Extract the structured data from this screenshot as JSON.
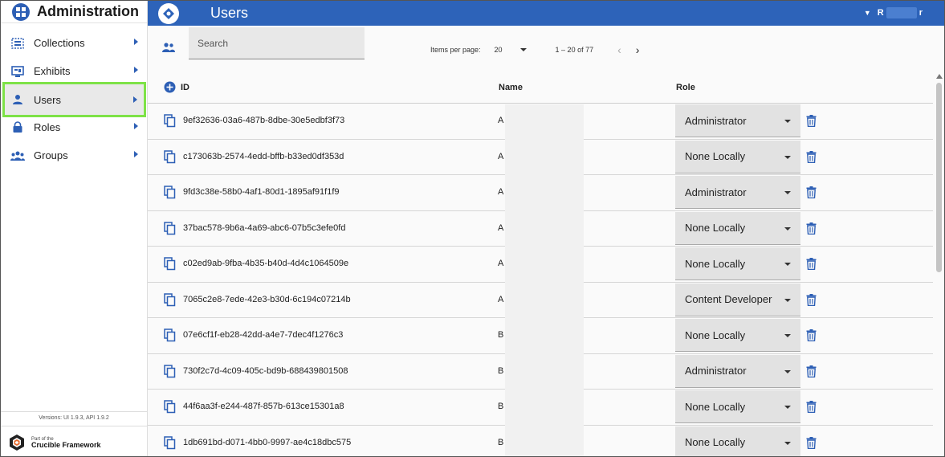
{
  "sidebar": {
    "title": "Administration",
    "items": [
      {
        "label": "Collections",
        "icon": "collections-icon"
      },
      {
        "label": "Exhibits",
        "icon": "exhibits-icon"
      },
      {
        "label": "Users",
        "icon": "user-icon",
        "active": true
      },
      {
        "label": "Roles",
        "icon": "lock-icon"
      },
      {
        "label": "Groups",
        "icon": "groups-icon"
      }
    ],
    "versions": "Versions: UI 1.9.3, API 1.9.2",
    "footer_small": "Part of the",
    "footer_big": "Crucible Framework"
  },
  "topbar": {
    "title": "Users",
    "user_initial": "R",
    "user_suffix": "r"
  },
  "toolbar": {
    "search_placeholder": "Search",
    "items_per_page_label": "Items per page:",
    "items_per_page": "20",
    "range": "1 – 20 of 77"
  },
  "table": {
    "headers": {
      "id": "ID",
      "name": "Name",
      "role": "Role"
    },
    "rows": [
      {
        "id": "9ef32636-03a6-487b-8dbe-30e5edbf3f73",
        "name": "A",
        "role": "Administrator"
      },
      {
        "id": "c173063b-2574-4edd-bffb-b33ed0df353d",
        "name": "A",
        "role": "None Locally"
      },
      {
        "id": "9fd3c38e-58b0-4af1-80d1-1895af91f1f9",
        "name": "A",
        "role": "Administrator"
      },
      {
        "id": "37bac578-9b6a-4a69-abc6-07b5c3efe0fd",
        "name": "A",
        "role": "None Locally"
      },
      {
        "id": "c02ed9ab-9fba-4b35-b40d-4d4c1064509e",
        "name": "A",
        "role": "None Locally"
      },
      {
        "id": "7065c2e8-7ede-42e3-b30d-6c194c07214b",
        "name": "A",
        "role": "Content Developer"
      },
      {
        "id": "07e6cf1f-eb28-42dd-a4e7-7dec4f1276c3",
        "name": "B",
        "role": "None Locally"
      },
      {
        "id": "730f2c7d-4c09-405c-bd9b-688439801508",
        "name": "B",
        "role": "Administrator"
      },
      {
        "id": "44f6aa3f-e244-487f-857b-613ce15301a8",
        "name": "B",
        "role": "None Locally"
      },
      {
        "id": "1db691bd-d071-4bb0-9997-ae4c18dbc575",
        "name": "B",
        "role": "None Locally"
      }
    ]
  },
  "colors": {
    "accent": "#2d63b9",
    "highlight": "#7ee247"
  }
}
